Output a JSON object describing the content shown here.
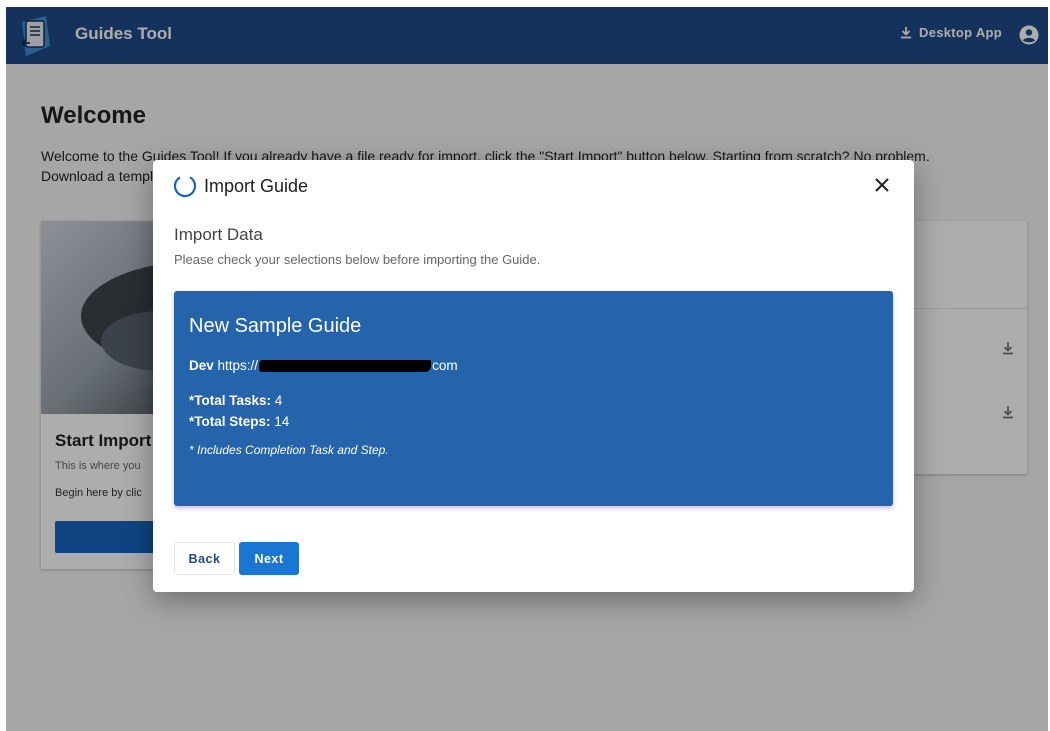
{
  "header": {
    "title": "Guides Tool",
    "desktop_app_label": "Desktop App",
    "icons": {
      "logo": "guide-document-icon",
      "download": "download-icon",
      "account": "account-circle-icon"
    }
  },
  "main": {
    "title": "Welcome",
    "intro_line1": "Welcome to the Guides Tool! If you already have a file ready for import, click the \"Start Import\" button below. Starting from scratch? No problem.",
    "intro_line2": "Download a template",
    "start_card": {
      "title": "Start Import",
      "subtitle": "This is where you",
      "body": "Begin here by clic"
    }
  },
  "dialog": {
    "title": "Import Guide",
    "step_title": "Import Data",
    "step_description": "Please check your selections below before importing the Guide.",
    "summary": {
      "guide_name": "New Sample Guide",
      "env_label": "Dev",
      "url_prefix": "https://",
      "url_suffix": "com",
      "tasks_label": "*Total Tasks:",
      "tasks_value": "4",
      "steps_label": "*Total Steps:",
      "steps_value": "14",
      "note": "* Includes Completion Task and Step."
    },
    "back_label": "Back",
    "next_label": "Next"
  },
  "colors": {
    "appbar": "#1f4b88",
    "summary_bg": "#2563ab",
    "primary_button": "#1976d2"
  }
}
